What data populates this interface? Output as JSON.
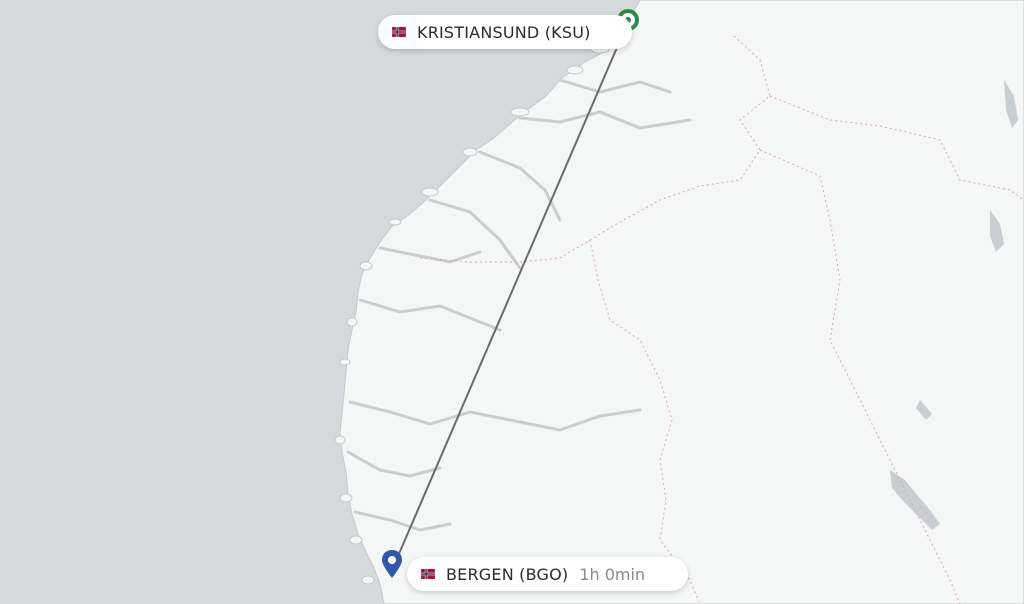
{
  "map": {
    "water_color": "#d5d9dc",
    "land_color": "#f5f6f6",
    "lake_color": "#c9ced2",
    "route_color": "#6b6b6b"
  },
  "origin": {
    "label": "KRISTIANSUND (KSU)",
    "marker_color": "#2e8b47",
    "flag_icon": "norway-flag-icon"
  },
  "destination": {
    "label": "BERGEN (BGO)",
    "duration": "1h 0min",
    "marker_color": "#3556a6",
    "flag_icon": "norway-flag-icon"
  }
}
